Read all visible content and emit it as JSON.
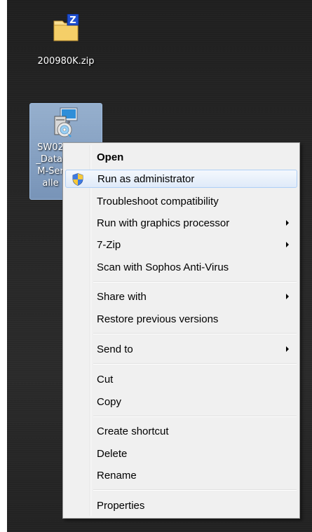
{
  "desktop": {
    "zip_icon": {
      "label": "200980K.zip",
      "icon": "zip-folder-icon"
    },
    "exe_icon": {
      "label_lines": [
        "SW02",
        "_Datal",
        "M-Ser",
        "alle"
      ],
      "icon": "installer-icon"
    }
  },
  "context_menu": {
    "items": [
      {
        "label": "Open",
        "bold": true
      },
      {
        "label": "Run as administrator",
        "icon": "uac-shield-icon",
        "highlighted": true
      },
      {
        "label": "Troubleshoot compatibility"
      },
      {
        "label": "Run with graphics processor",
        "submenu": true
      },
      {
        "label": "7-Zip",
        "submenu": true
      },
      {
        "label": "Scan with Sophos Anti-Virus"
      },
      {
        "label": "Share with",
        "submenu": true
      },
      {
        "label": "Restore previous versions"
      },
      {
        "label": "Send to",
        "submenu": true
      },
      {
        "label": "Cut"
      },
      {
        "label": "Copy"
      },
      {
        "label": "Create shortcut"
      },
      {
        "label": "Delete"
      },
      {
        "label": "Rename"
      },
      {
        "label": "Properties"
      }
    ]
  },
  "colors": {
    "menu_background": "#f0f0f0",
    "highlight_border": "#aecff7",
    "selection_blue": "#9dbbe0"
  }
}
